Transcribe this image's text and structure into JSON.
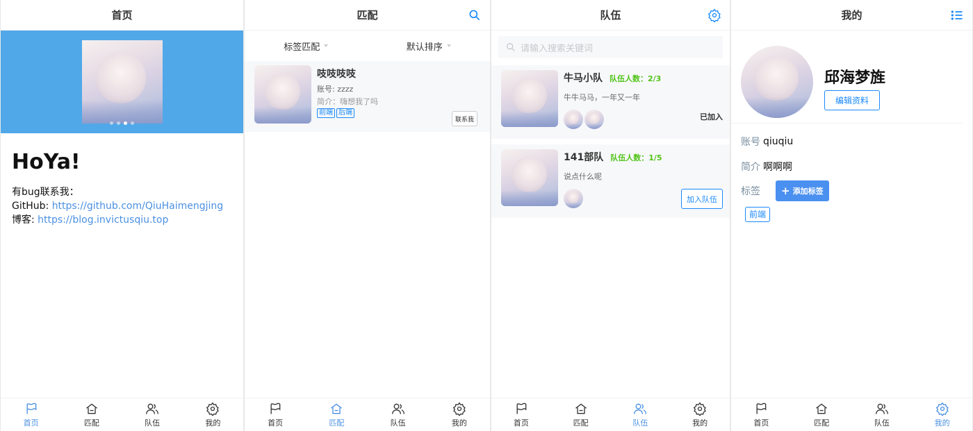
{
  "tabbar": [
    "首页",
    "匹配",
    "队伍",
    "我的"
  ],
  "home": {
    "title": "首页",
    "hello": "HoYa!",
    "contact_line": "有bug联系我：",
    "github_label": "GitHub: ",
    "github_url": "https://github.com/QiuHaimengjing",
    "blog_label": "博客: ",
    "blog_url": "https://blog.invictusqiu.top"
  },
  "match": {
    "title": "匹配",
    "filter_tag": "标签匹配",
    "filter_sort": "默认排序",
    "user": {
      "name": "吱吱吱吱",
      "account": "账号: zzzz",
      "intro": "简介：嗨想我了吗",
      "tags": [
        "前端",
        "后端"
      ],
      "contact_btn": "联系我"
    }
  },
  "team": {
    "title": "队伍",
    "search_placeholder": "请输入搜索关键词",
    "teams": [
      {
        "name": "牛马小队",
        "count": "队伍人数：2/3",
        "desc": "牛牛马马，一年又一年",
        "status": "已加入",
        "members": 2
      },
      {
        "name": "141部队",
        "count": "队伍人数：1/5",
        "desc": "说点什么呢",
        "status": "加入队伍",
        "members": 1
      }
    ]
  },
  "mine": {
    "title": "我的",
    "name": "邱海梦旌",
    "edit_btn": "编辑资料",
    "account_label": "账号",
    "account": "qiuqiu",
    "intro_label": "简介",
    "intro": "啊啊啊",
    "tags_label": "标签",
    "add_tag_btn": "添加标签",
    "tags": [
      "前端"
    ]
  },
  "colors": {
    "accent": "#1989fa",
    "banner": "#50a8e8",
    "success": "#52c41a"
  }
}
